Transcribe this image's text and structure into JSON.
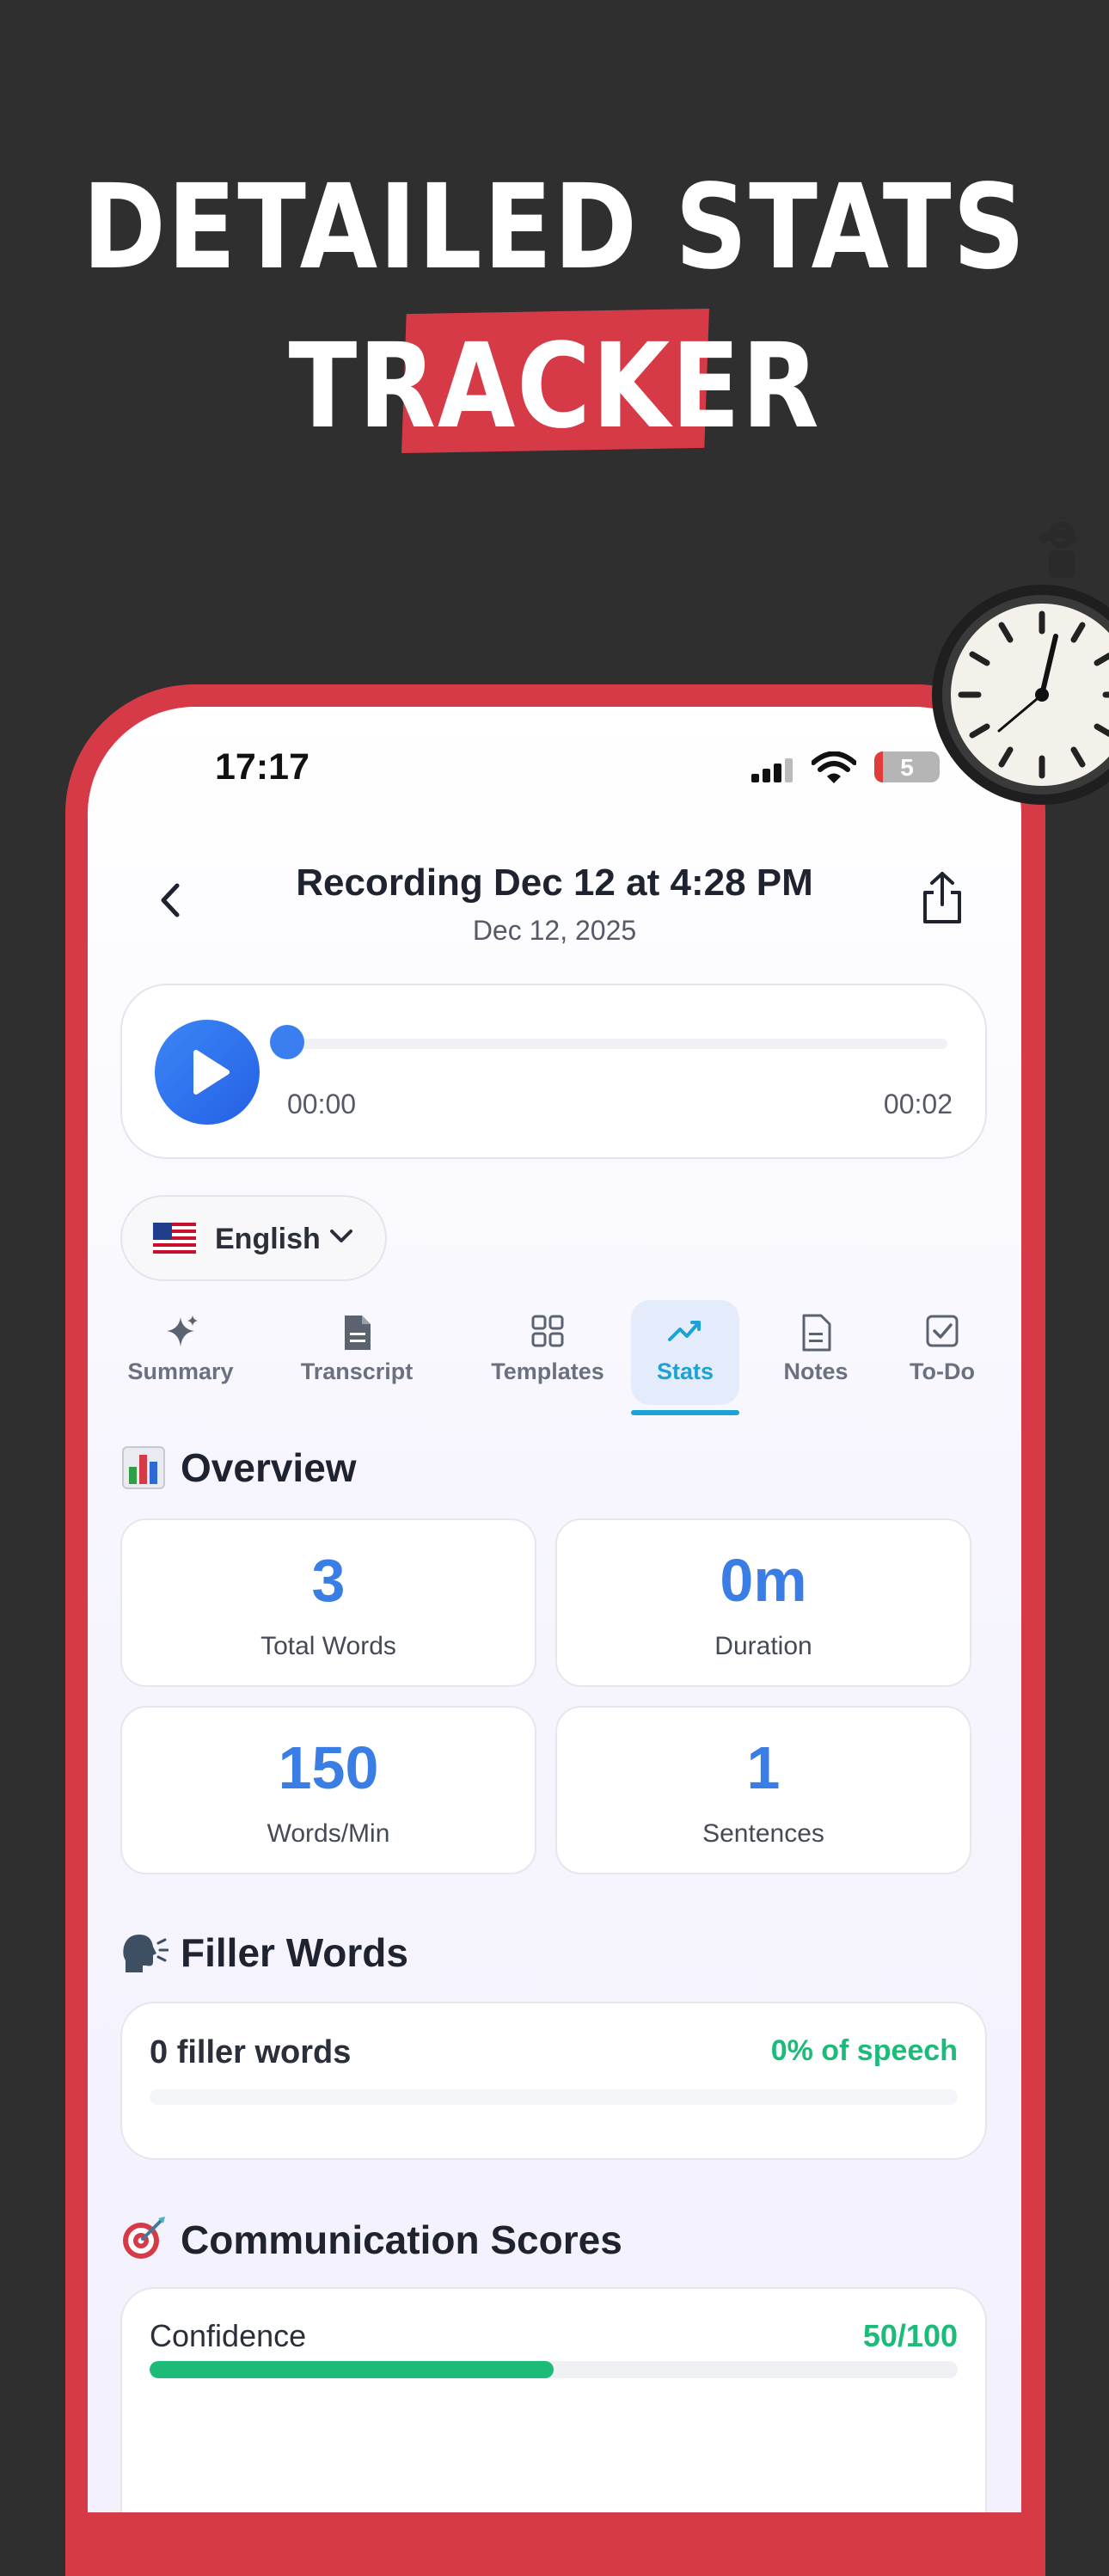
{
  "headline": {
    "line1": "DETAILED STATS",
    "line2": "TRACKER"
  },
  "status_bar": {
    "time": "17:17",
    "battery": "5"
  },
  "nav": {
    "title": "Recording Dec 12 at 4:28 PM",
    "subtitle": "Dec 12, 2025"
  },
  "player": {
    "current_time": "00:00",
    "total_time": "00:02",
    "progress": 0
  },
  "language": {
    "label": "English"
  },
  "tabs": [
    {
      "label": "Summary",
      "icon": "sparkles-icon"
    },
    {
      "label": "Transcript",
      "icon": "document-icon"
    },
    {
      "label": "Templates",
      "icon": "grid-icon"
    },
    {
      "label": "Stats",
      "icon": "trend-icon",
      "active": true
    },
    {
      "label": "Notes",
      "icon": "note-icon"
    },
    {
      "label": "To-Do",
      "icon": "checkbox-icon"
    }
  ],
  "overview": {
    "title": "Overview",
    "icon": "bar-chart-icon",
    "cards": [
      {
        "value": "3",
        "label": "Total Words"
      },
      {
        "value": "0m",
        "label": "Duration"
      },
      {
        "value": "150",
        "label": "Words/Min"
      },
      {
        "value": "1",
        "label": "Sentences"
      }
    ]
  },
  "filler_words": {
    "title": "Filler Words",
    "icon": "speaking-head-icon",
    "count_text": "0 filler words",
    "percent_text": "0% of speech",
    "percent": 0
  },
  "communication_scores": {
    "title": "Communication Scores",
    "icon": "target-icon",
    "items": [
      {
        "label": "Confidence",
        "value_text": "50/100",
        "score": 50
      }
    ]
  },
  "colors": {
    "accent_red": "#d63a46",
    "accent_blue": "#3a7de5",
    "accent_green": "#1dbb7a",
    "active_tab": "#1aa3d4"
  }
}
